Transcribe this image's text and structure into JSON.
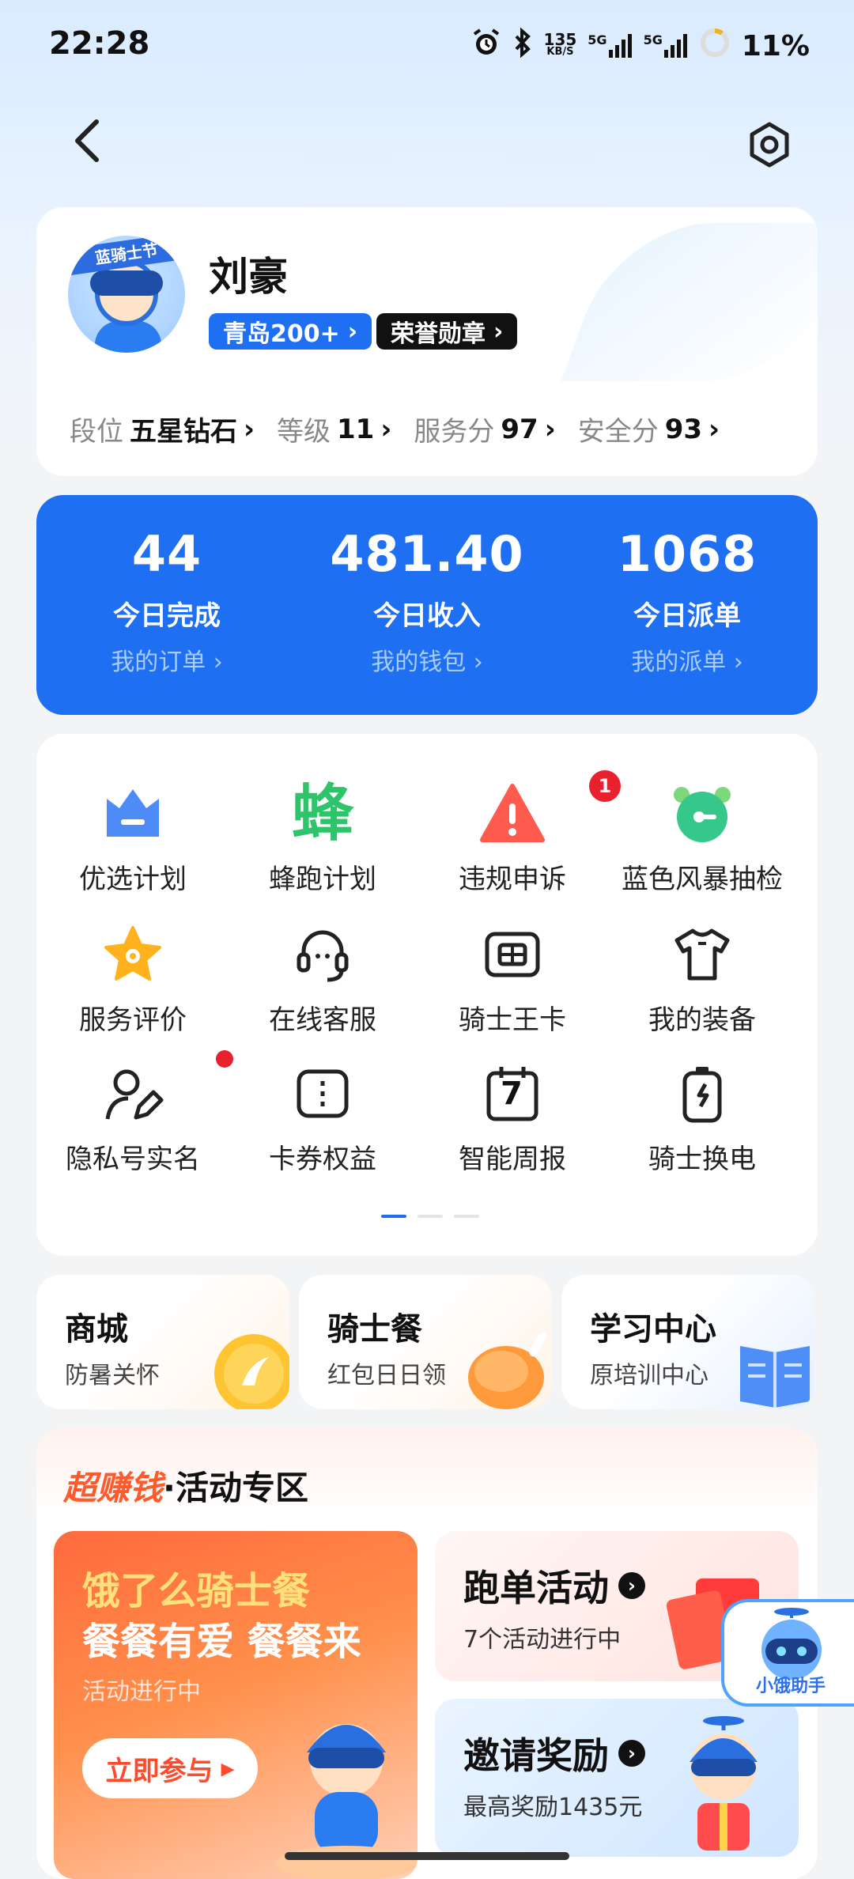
{
  "status_bar": {
    "time": "22:28",
    "net_speed_top": "135",
    "net_speed_unit": "KB/S",
    "sig1": "5G",
    "sig2": "5G",
    "battery": "11%"
  },
  "profile": {
    "name": "刘豪",
    "avatar_banner": "蓝骑士节",
    "tags": [
      "青岛200+",
      "荣誉勋章"
    ],
    "stats": [
      {
        "key": "段位",
        "value": "五星钻石"
      },
      {
        "key": "等级",
        "value": "11"
      },
      {
        "key": "服务分",
        "value": "97"
      },
      {
        "key": "安全分",
        "value": "93"
      }
    ]
  },
  "summary": [
    {
      "value": "44",
      "label": "今日完成",
      "link": "我的订单 ›"
    },
    {
      "value": "481.40",
      "label": "今日收入",
      "link": "我的钱包 ›"
    },
    {
      "value": "1068",
      "label": "今日派单",
      "link": "我的派单 ›"
    }
  ],
  "grid": [
    {
      "label": "优选计划",
      "icon": "crown-icon"
    },
    {
      "label": "蜂跑计划",
      "icon": "bee-icon",
      "glyph": "蜂"
    },
    {
      "label": "违规申诉",
      "icon": "warning-icon",
      "badge": "1"
    },
    {
      "label": "蓝色风暴抽检",
      "icon": "alarm-clock-icon"
    },
    {
      "label": "服务评价",
      "icon": "star-icon"
    },
    {
      "label": "在线客服",
      "icon": "headset-icon"
    },
    {
      "label": "骑士王卡",
      "icon": "sim-card-icon"
    },
    {
      "label": "我的装备",
      "icon": "tshirt-icon"
    },
    {
      "label": "隐私号实名",
      "icon": "user-edit-icon",
      "dot": true
    },
    {
      "label": "卡券权益",
      "icon": "coupon-icon"
    },
    {
      "label": "智能周报",
      "icon": "calendar-icon",
      "glyph": "7"
    },
    {
      "label": "骑士换电",
      "icon": "battery-icon"
    }
  ],
  "mini_cards": [
    {
      "title": "商城",
      "sub": "防暑关怀"
    },
    {
      "title": "骑士餐",
      "sub": "红包日日领"
    },
    {
      "title": "学习中心",
      "sub": "原培训中心"
    }
  ],
  "activity": {
    "title_hot": "超赚钱",
    "title_rest": "·活动专区",
    "banner": {
      "line1": "饿了么骑士餐",
      "line2": "餐餐有爱 餐餐来",
      "status": "活动进行中",
      "button": "立即参与"
    },
    "cards": [
      {
        "title": "跑单活动",
        "sub": "7个活动进行中"
      },
      {
        "title": "邀请奖励",
        "sub": "最高奖励1435元"
      }
    ]
  },
  "assistant": {
    "label": "小饿助手"
  },
  "colors": {
    "primary": "#1f6ff2",
    "hot": "#ff5a2b",
    "badge": "#e9202d"
  }
}
